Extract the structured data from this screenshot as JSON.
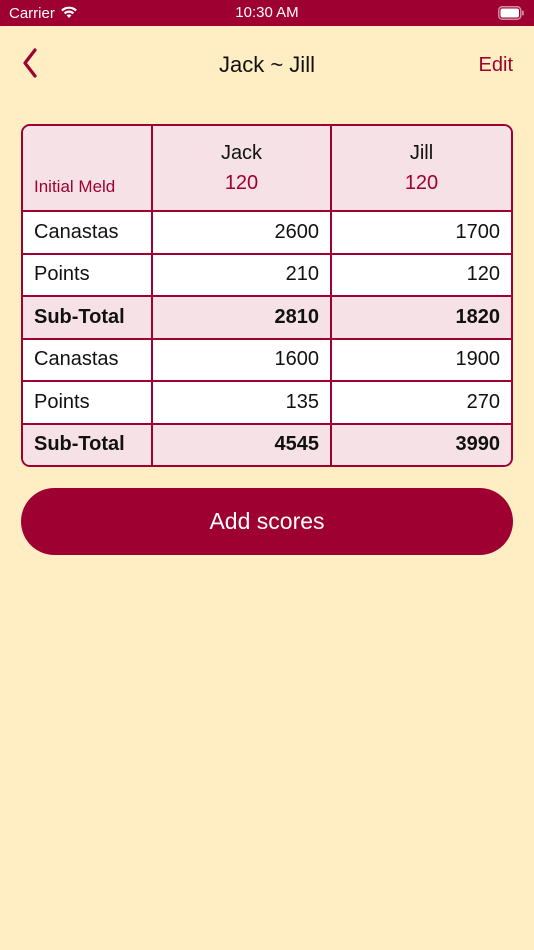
{
  "status_bar": {
    "carrier": "Carrier",
    "time": "10:30 AM",
    "icons": [
      "wifi-icon",
      "battery-icon"
    ]
  },
  "nav": {
    "back_icon": "chevron-left-icon",
    "title": "Jack ~ Jill",
    "edit_label": "Edit"
  },
  "table": {
    "meld_label": "Initial Meld",
    "players": [
      {
        "name": "Jack",
        "meld": "120"
      },
      {
        "name": "Jill",
        "meld": "120"
      }
    ],
    "rows": [
      {
        "label": "Canastas",
        "values": [
          "2600",
          "1700"
        ],
        "subtotal": false
      },
      {
        "label": "Points",
        "values": [
          "210",
          "120"
        ],
        "subtotal": false
      },
      {
        "label": "Sub-Total",
        "values": [
          "2810",
          "1820"
        ],
        "subtotal": true
      },
      {
        "label": "Canastas",
        "values": [
          "1600",
          "1900"
        ],
        "subtotal": false
      },
      {
        "label": "Points",
        "values": [
          "135",
          "270"
        ],
        "subtotal": false
      },
      {
        "label": "Sub-Total",
        "values": [
          "4545",
          "3990"
        ],
        "subtotal": true
      }
    ]
  },
  "add_button_label": "Add scores",
  "colors": {
    "accent": "#9E0031",
    "background": "#FFEEC4",
    "header_fill": "#F6E2E6"
  }
}
